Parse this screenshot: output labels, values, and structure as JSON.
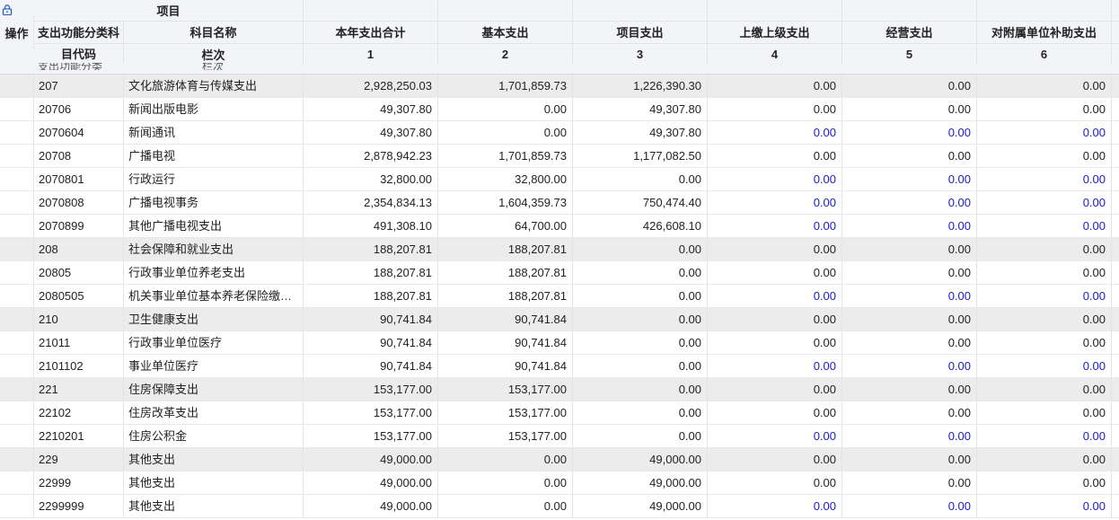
{
  "header": {
    "op": "操作",
    "project": "项目",
    "code_line1": "支出功能分类科",
    "code_line2": "目代码",
    "name": "科目名称",
    "lanci": "栏次",
    "cols": [
      {
        "title": "本年支出合计",
        "no": "1"
      },
      {
        "title": "基本支出",
        "no": "2"
      },
      {
        "title": "项目支出",
        "no": "3"
      },
      {
        "title": "上缴上级支出",
        "no": "4"
      },
      {
        "title": "经营支出",
        "no": "5"
      },
      {
        "title": "对附属单位补助支出",
        "no": "6"
      }
    ]
  },
  "accent": {
    "link_blue": "#1a1acb",
    "group_row": "#ececec",
    "header_bg": "#f3f4f7"
  },
  "rows": [
    {
      "code": "207",
      "name": "文化旅游体育与传媒支出",
      "v": [
        "2,928,250.03",
        "1,701,859.73",
        "1,226,390.30",
        "0.00",
        "0.00",
        "0.00"
      ],
      "group": true,
      "blue": false
    },
    {
      "code": "20706",
      "name": "新闻出版电影",
      "v": [
        "49,307.80",
        "0.00",
        "49,307.80",
        "0.00",
        "0.00",
        "0.00"
      ],
      "group": false,
      "blue": false
    },
    {
      "code": "2070604",
      "name": "新闻通讯",
      "v": [
        "49,307.80",
        "0.00",
        "49,307.80",
        "0.00",
        "0.00",
        "0.00"
      ],
      "group": false,
      "blue": true
    },
    {
      "code": "20708",
      "name": "广播电视",
      "v": [
        "2,878,942.23",
        "1,701,859.73",
        "1,177,082.50",
        "0.00",
        "0.00",
        "0.00"
      ],
      "group": false,
      "blue": false
    },
    {
      "code": "2070801",
      "name": "行政运行",
      "v": [
        "32,800.00",
        "32,800.00",
        "0.00",
        "0.00",
        "0.00",
        "0.00"
      ],
      "group": false,
      "blue": true
    },
    {
      "code": "2070808",
      "name": "广播电视事务",
      "v": [
        "2,354,834.13",
        "1,604,359.73",
        "750,474.40",
        "0.00",
        "0.00",
        "0.00"
      ],
      "group": false,
      "blue": true
    },
    {
      "code": "2070899",
      "name": "其他广播电视支出",
      "v": [
        "491,308.10",
        "64,700.00",
        "426,608.10",
        "0.00",
        "0.00",
        "0.00"
      ],
      "group": false,
      "blue": true
    },
    {
      "code": "208",
      "name": "社会保障和就业支出",
      "v": [
        "188,207.81",
        "188,207.81",
        "0.00",
        "0.00",
        "0.00",
        "0.00"
      ],
      "group": true,
      "blue": false
    },
    {
      "code": "20805",
      "name": "行政事业单位养老支出",
      "v": [
        "188,207.81",
        "188,207.81",
        "0.00",
        "0.00",
        "0.00",
        "0.00"
      ],
      "group": false,
      "blue": false
    },
    {
      "code": "2080505",
      "name": "机关事业单位基本养老保险缴…",
      "v": [
        "188,207.81",
        "188,207.81",
        "0.00",
        "0.00",
        "0.00",
        "0.00"
      ],
      "group": false,
      "blue": true
    },
    {
      "code": "210",
      "name": "卫生健康支出",
      "v": [
        "90,741.84",
        "90,741.84",
        "0.00",
        "0.00",
        "0.00",
        "0.00"
      ],
      "group": true,
      "blue": false
    },
    {
      "code": "21011",
      "name": "行政事业单位医疗",
      "v": [
        "90,741.84",
        "90,741.84",
        "0.00",
        "0.00",
        "0.00",
        "0.00"
      ],
      "group": false,
      "blue": false
    },
    {
      "code": "2101102",
      "name": "事业单位医疗",
      "v": [
        "90,741.84",
        "90,741.84",
        "0.00",
        "0.00",
        "0.00",
        "0.00"
      ],
      "group": false,
      "blue": true
    },
    {
      "code": "221",
      "name": "住房保障支出",
      "v": [
        "153,177.00",
        "153,177.00",
        "0.00",
        "0.00",
        "0.00",
        "0.00"
      ],
      "group": true,
      "blue": false
    },
    {
      "code": "22102",
      "name": "住房改革支出",
      "v": [
        "153,177.00",
        "153,177.00",
        "0.00",
        "0.00",
        "0.00",
        "0.00"
      ],
      "group": false,
      "blue": false
    },
    {
      "code": "2210201",
      "name": "住房公积金",
      "v": [
        "153,177.00",
        "153,177.00",
        "0.00",
        "0.00",
        "0.00",
        "0.00"
      ],
      "group": false,
      "blue": true
    },
    {
      "code": "229",
      "name": "其他支出",
      "v": [
        "49,000.00",
        "0.00",
        "49,000.00",
        "0.00",
        "0.00",
        "0.00"
      ],
      "group": true,
      "blue": false
    },
    {
      "code": "22999",
      "name": "其他支出",
      "v": [
        "49,000.00",
        "0.00",
        "49,000.00",
        "0.00",
        "0.00",
        "0.00"
      ],
      "group": false,
      "blue": false
    },
    {
      "code": "2299999",
      "name": "其他支出",
      "v": [
        "49,000.00",
        "0.00",
        "49,000.00",
        "0.00",
        "0.00",
        "0.00"
      ],
      "group": false,
      "blue": true
    }
  ]
}
